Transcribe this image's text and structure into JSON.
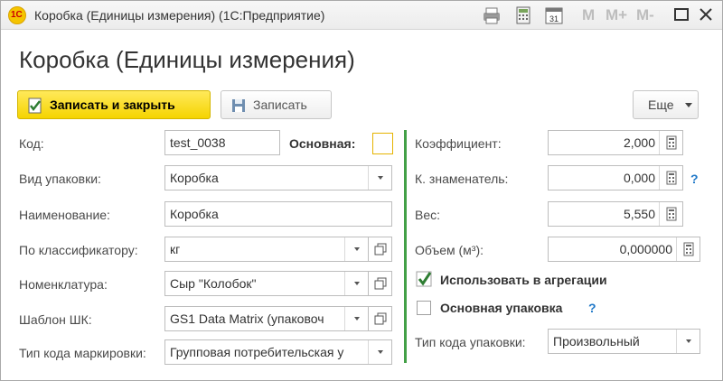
{
  "window": {
    "title": "Коробка (Единицы измерения)  (1С:Предприятие)",
    "logo_text": "1С",
    "m_labels": [
      "M",
      "M+",
      "M-"
    ]
  },
  "form": {
    "title": "Коробка (Единицы измерения)"
  },
  "toolbar": {
    "save_close_label": "Записать и закрыть",
    "save_label": "Записать",
    "more_label": "Еще"
  },
  "fields": {
    "code": {
      "label": "Код:",
      "value": "test_0038"
    },
    "main": {
      "label": "Основная:",
      "checked": false
    },
    "pack_type": {
      "label": "Вид упаковки:",
      "value": "Коробка"
    },
    "name": {
      "label": "Наименование:",
      "value": "Коробка"
    },
    "classifier": {
      "label": "По классификатору:",
      "value": "кг"
    },
    "nomenclature": {
      "label": "Номенклатура:",
      "value": "Сыр \"Колобок\""
    },
    "barcode_template": {
      "label": "Шаблон ШК:",
      "value": "GS1 Data Matrix (упаковоч"
    },
    "marking_code_type": {
      "label": "Тип кода маркировки:",
      "value": "Групповая потребительская у"
    },
    "coefficient": {
      "label": "Коэффициент:",
      "value": "2,000"
    },
    "denominator": {
      "label": "К. знаменатель:",
      "value": "0,000"
    },
    "weight": {
      "label": "Вес:",
      "value": "5,550"
    },
    "volume": {
      "label": "Объем (м³):",
      "value": "0,000000"
    },
    "use_in_aggregation": {
      "label": "Использовать в агрегации",
      "checked": true
    },
    "main_package": {
      "label": "Основная упаковка",
      "checked": false
    },
    "package_code_type": {
      "label": "Тип кода упаковки:",
      "value": "Произвольный"
    }
  },
  "help_mark": "?",
  "colors": {
    "primary_button": "#f5d400",
    "separator": "#43a047",
    "help": "#1f78c8",
    "check": "#2e7d32"
  }
}
